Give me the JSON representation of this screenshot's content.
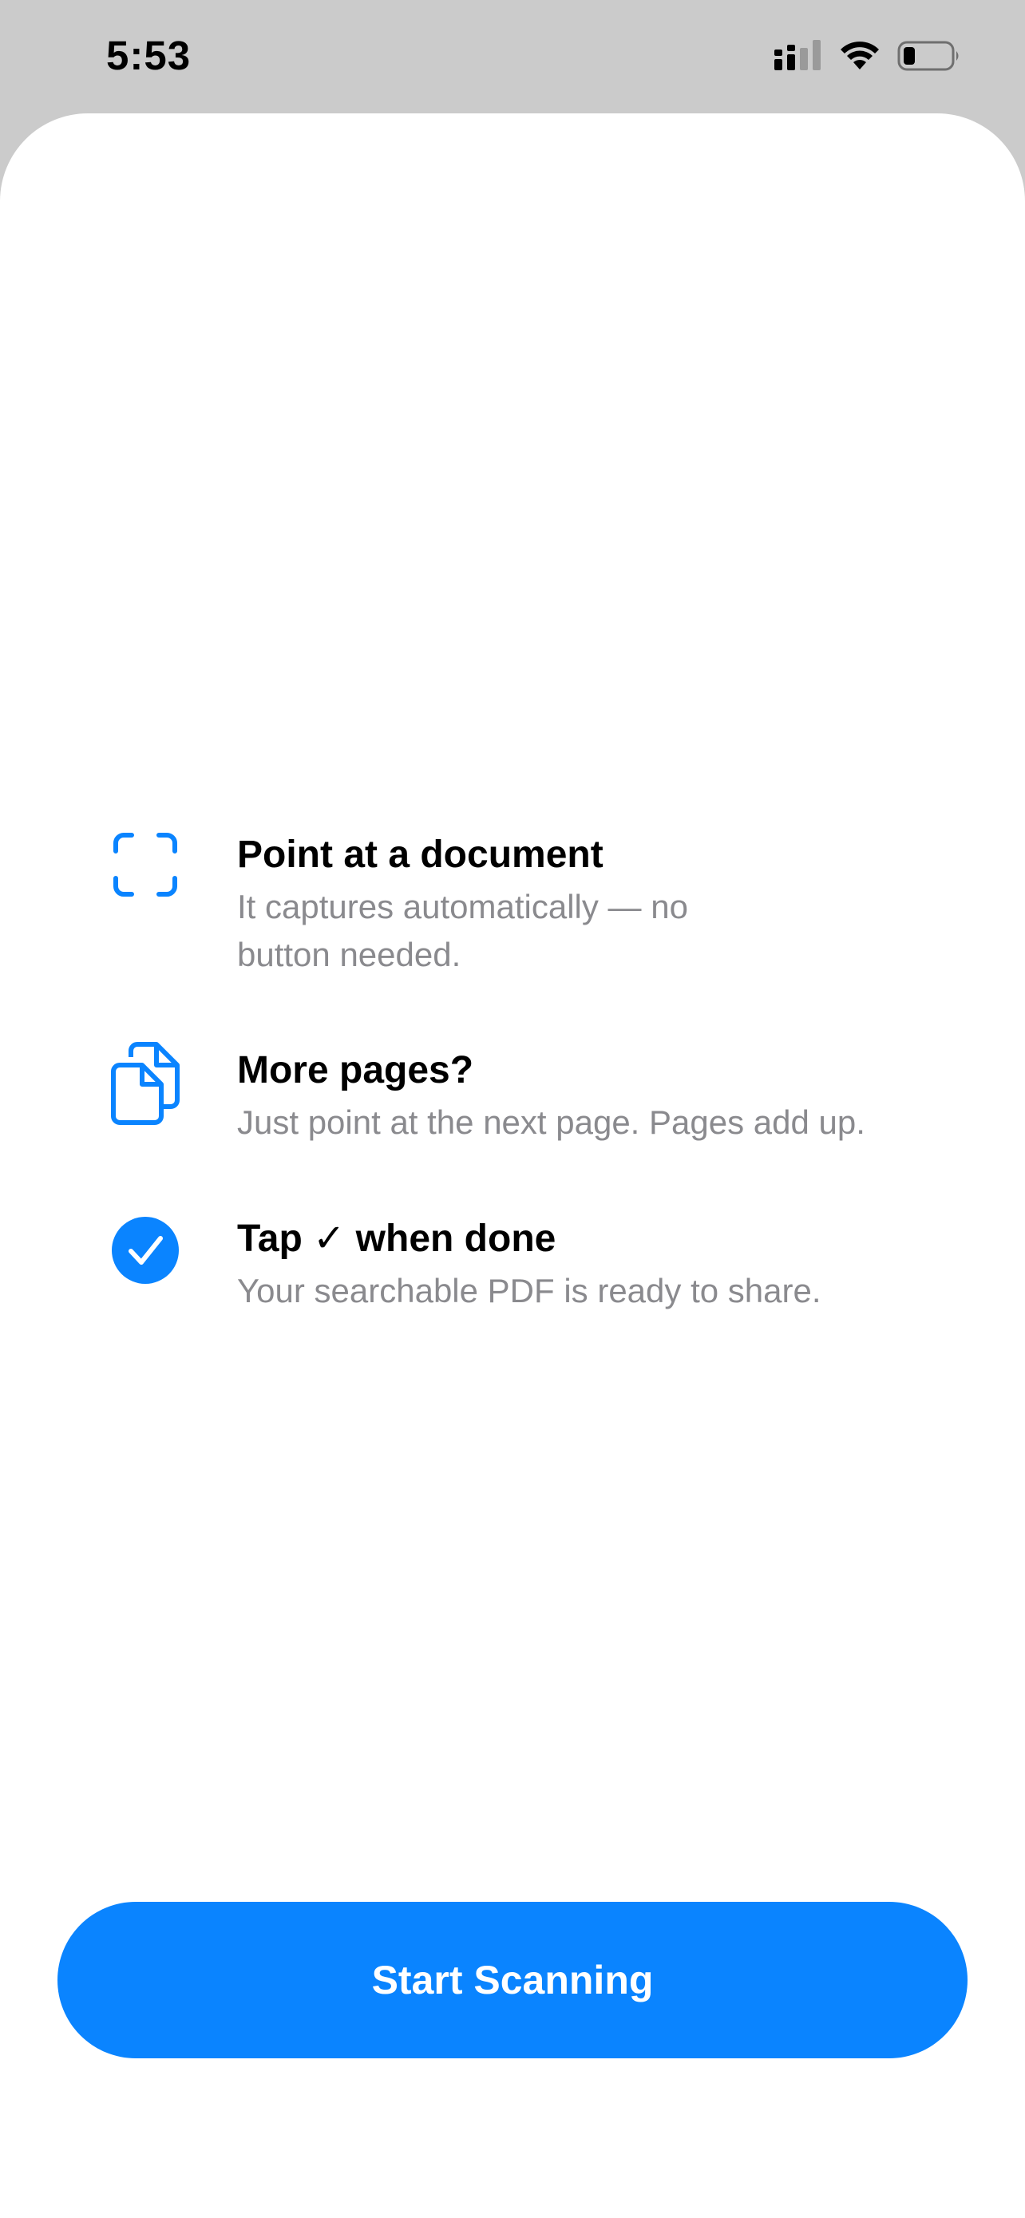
{
  "status_bar": {
    "time": "5:53",
    "icons": [
      "cellular-signal-icon",
      "wifi-icon",
      "battery-icon"
    ]
  },
  "tips": [
    {
      "icon": "viewfinder-icon",
      "title": "Point at a document",
      "description_lines": [
        "It captures automatically — no",
        "button needed."
      ]
    },
    {
      "icon": "documents-icon",
      "title": "More pages?",
      "description_lines": [
        "Just point at the next page. Pages add up."
      ]
    },
    {
      "icon": "checkmark-circle-icon",
      "title": "Tap ✓ when done",
      "description_lines": [
        "Your searchable PDF is ready to share."
      ]
    }
  ],
  "start_button": {
    "label": "Start Scanning"
  },
  "colors": {
    "accent": "#0a84ff",
    "background": "#ffffff",
    "status_bar_bg": "#cbcbcb",
    "title_text": "#000000",
    "secondary_text": "#8a8a8e"
  }
}
